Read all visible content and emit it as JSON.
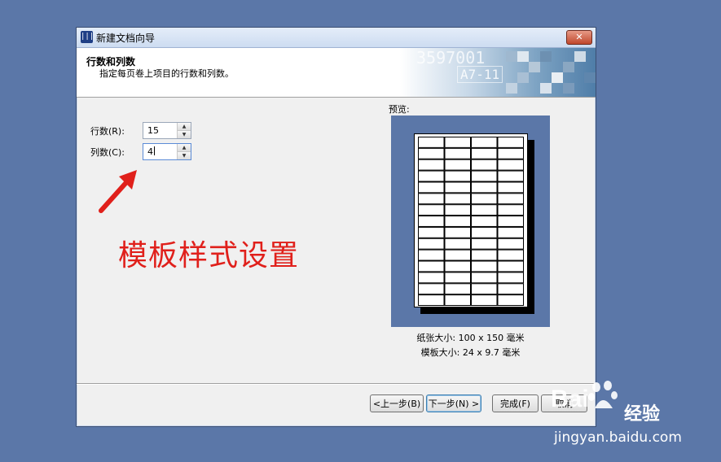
{
  "window": {
    "title": "新建文档向导",
    "app_icon": "barcode-icon",
    "close_label": "✕"
  },
  "header": {
    "title": "行数和列数",
    "subtitle": "指定每页卷上项目的行数和列数。",
    "banner_text_1": "3597001",
    "banner_text_2": "A7-11"
  },
  "fields": {
    "rows_label": "行数(R):",
    "rows_value": "15",
    "cols_label": "列数(C):",
    "cols_value": "4"
  },
  "preview": {
    "label": "预览:",
    "rows": 15,
    "cols": 4,
    "paper_size": "纸张大小:  100 x 150 毫米",
    "template_size": "模板大小:  24 x 9.7 毫米"
  },
  "buttons": {
    "back": "<上一步(B)",
    "next": "下一步(N) >",
    "finish": "完成(F)",
    "cancel": "取消"
  },
  "annotation": {
    "text": "模板样式设置",
    "color": "#e0201b"
  },
  "watermark": {
    "logo": "Bai",
    "brand": "经验",
    "url": "jingyan.baidu.com"
  }
}
